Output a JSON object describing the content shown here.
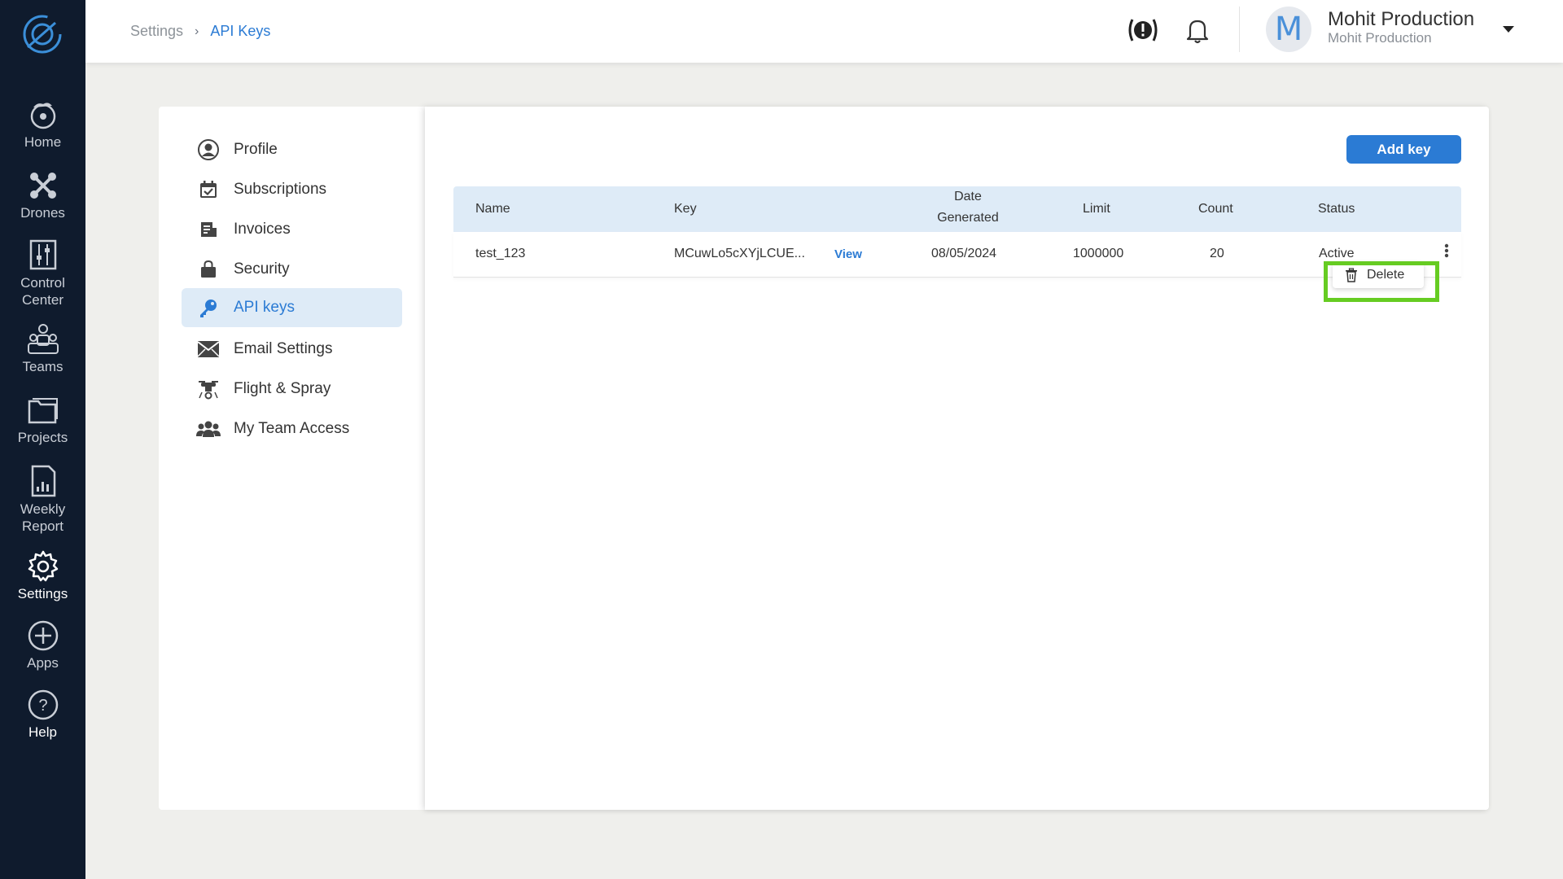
{
  "rail": {
    "items": [
      {
        "label": "Home",
        "icon": "home-drone-icon"
      },
      {
        "label": "Drones",
        "icon": "drone-icon"
      },
      {
        "label": "Control Center",
        "icon": "control-center-icon"
      },
      {
        "label": "Teams",
        "icon": "teams-icon"
      },
      {
        "label": "Projects",
        "icon": "folder-icon"
      },
      {
        "label": "Weekly Report",
        "icon": "report-icon"
      },
      {
        "label": "Settings",
        "icon": "gear-icon",
        "active": true
      },
      {
        "label": "Apps",
        "icon": "plus-circle-icon"
      },
      {
        "label": "Help",
        "icon": "help-icon"
      }
    ]
  },
  "breadcrumb": {
    "parent": "Settings",
    "current": "API Keys"
  },
  "user": {
    "initial": "M",
    "name": "Mohit Production",
    "org": "Mohit Production"
  },
  "settings_nav": {
    "items": [
      {
        "label": "Profile",
        "icon": "user-circle-icon"
      },
      {
        "label": "Subscriptions",
        "icon": "calendar-check-icon"
      },
      {
        "label": "Invoices",
        "icon": "invoice-icon"
      },
      {
        "label": "Security",
        "icon": "lock-bag-icon"
      },
      {
        "label": "API keys",
        "icon": "key-icon",
        "active": true
      },
      {
        "label": "Email Settings",
        "icon": "envelope-icon"
      },
      {
        "label": "Flight & Spray",
        "icon": "spray-drone-icon"
      },
      {
        "label": "My Team Access",
        "icon": "team-access-icon"
      }
    ]
  },
  "api_keys": {
    "add_button": "Add key",
    "columns": {
      "name": "Name",
      "key": "Key",
      "date_line1": "Date",
      "date_line2": "Generated",
      "limit": "Limit",
      "count": "Count",
      "status": "Status"
    },
    "rows": [
      {
        "name": "test_123",
        "key": "MCuwLo5cXYjLCUE...",
        "view": "View",
        "date": "08/05/2024",
        "limit": "1000000",
        "count": "20",
        "status": "Active"
      }
    ],
    "row_menu": {
      "delete": "Delete"
    }
  },
  "colors": {
    "accent": "#2b7bd4",
    "rail_bg": "#0f1b2d",
    "header_bg": "#deebf7",
    "highlight": "#66cc22"
  }
}
